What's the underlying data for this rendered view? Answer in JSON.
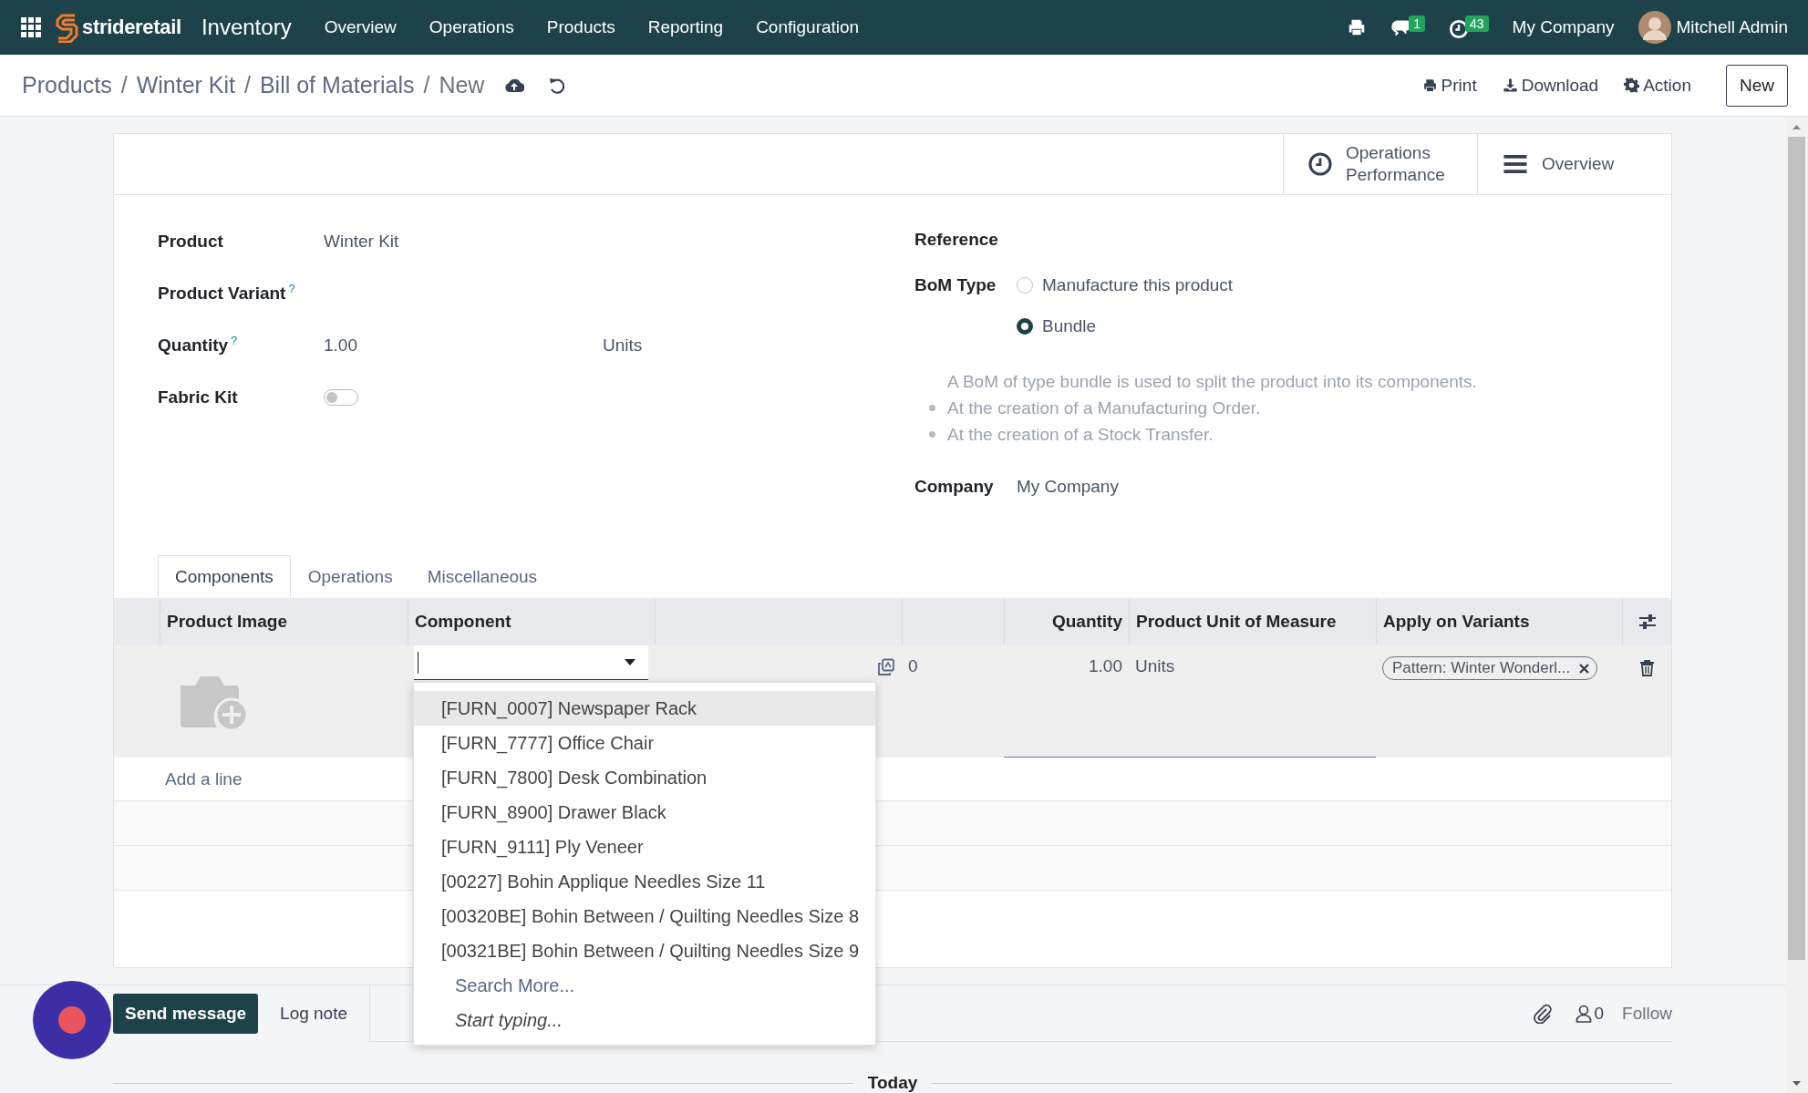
{
  "navbar": {
    "brand": "strideretail",
    "app": "Inventory",
    "menu": [
      "Overview",
      "Operations",
      "Products",
      "Reporting",
      "Configuration"
    ],
    "messages_badge": "1",
    "activities_badge": "43",
    "company": "My Company",
    "user": "Mitchell Admin"
  },
  "breadcrumb": {
    "separator": "/",
    "items": [
      "Products",
      "Winter Kit",
      "Bill of Materials",
      "New"
    ]
  },
  "actions": [
    "Print",
    "Download",
    "Action"
  ],
  "new_button": "New",
  "smart_buttons": [
    "Operations Performance",
    "Overview"
  ],
  "left_fields": [
    {
      "kind": "text",
      "label": "Product",
      "value": "Winter Kit"
    },
    {
      "kind": "text",
      "label": "Product Variant",
      "help": "?"
    },
    {
      "kind": "quantity",
      "label": "Quantity",
      "help": "?",
      "value": "1.00",
      "unit": "Units"
    },
    {
      "kind": "toggle",
      "label": "Fabric Kit",
      "on": false
    }
  ],
  "reference": {
    "label": "Reference"
  },
  "bom_type": {
    "label": "BoM Type",
    "options": [
      {
        "label": "Manufacture this product",
        "selected": false
      },
      {
        "label": "Bundle",
        "selected": true
      }
    ]
  },
  "bom_note": {
    "intro": "A BoM of type bundle is used to split the product into its components.",
    "bullets": [
      "At the creation of a Manufacturing Order.",
      "At the creation of a Stock Transfer."
    ]
  },
  "company": {
    "label": "Company",
    "value": "My Company"
  },
  "tabs": [
    {
      "label": "Components",
      "selected": true
    },
    {
      "label": "Operations",
      "selected": false
    },
    {
      "label": "Miscellaneous",
      "selected": false
    }
  ],
  "table": {
    "columns": [
      "Product Image",
      "Component",
      "Quantity",
      "Product Unit of Measure",
      "Apply on Variants"
    ],
    "rows": [
      {
        "forecast": "0",
        "quantity": "1.00",
        "uom": "Units",
        "variant_tag": "Pattern: Winter Wonderl..."
      }
    ],
    "add_line": "Add a line"
  },
  "dropdown": {
    "items": [
      {
        "label": "[FURN_0007] Newspaper Rack",
        "selected": true
      },
      {
        "label": "[FURN_7777] Office Chair",
        "selected": false
      },
      {
        "label": "[FURN_7800] Desk Combination",
        "selected": false
      },
      {
        "label": "[FURN_8900] Drawer Black",
        "selected": false
      },
      {
        "label": "[FURN_9111] Ply Veneer",
        "selected": false
      },
      {
        "label": "[00227] Bohin Applique Needles Size 11",
        "selected": false
      },
      {
        "label": "[00320BE] Bohin Between / Quilting Needles Size 8",
        "selected": false
      },
      {
        "label": "[00321BE] Bohin Between / Quilting Needles Size 9",
        "selected": false
      }
    ],
    "search_more": "Search More...",
    "start_typing": "Start typing..."
  },
  "chatter": {
    "send": "Send message",
    "log": "Log note",
    "followers": "0",
    "follow": "Follow",
    "date_separator": "Today"
  }
}
